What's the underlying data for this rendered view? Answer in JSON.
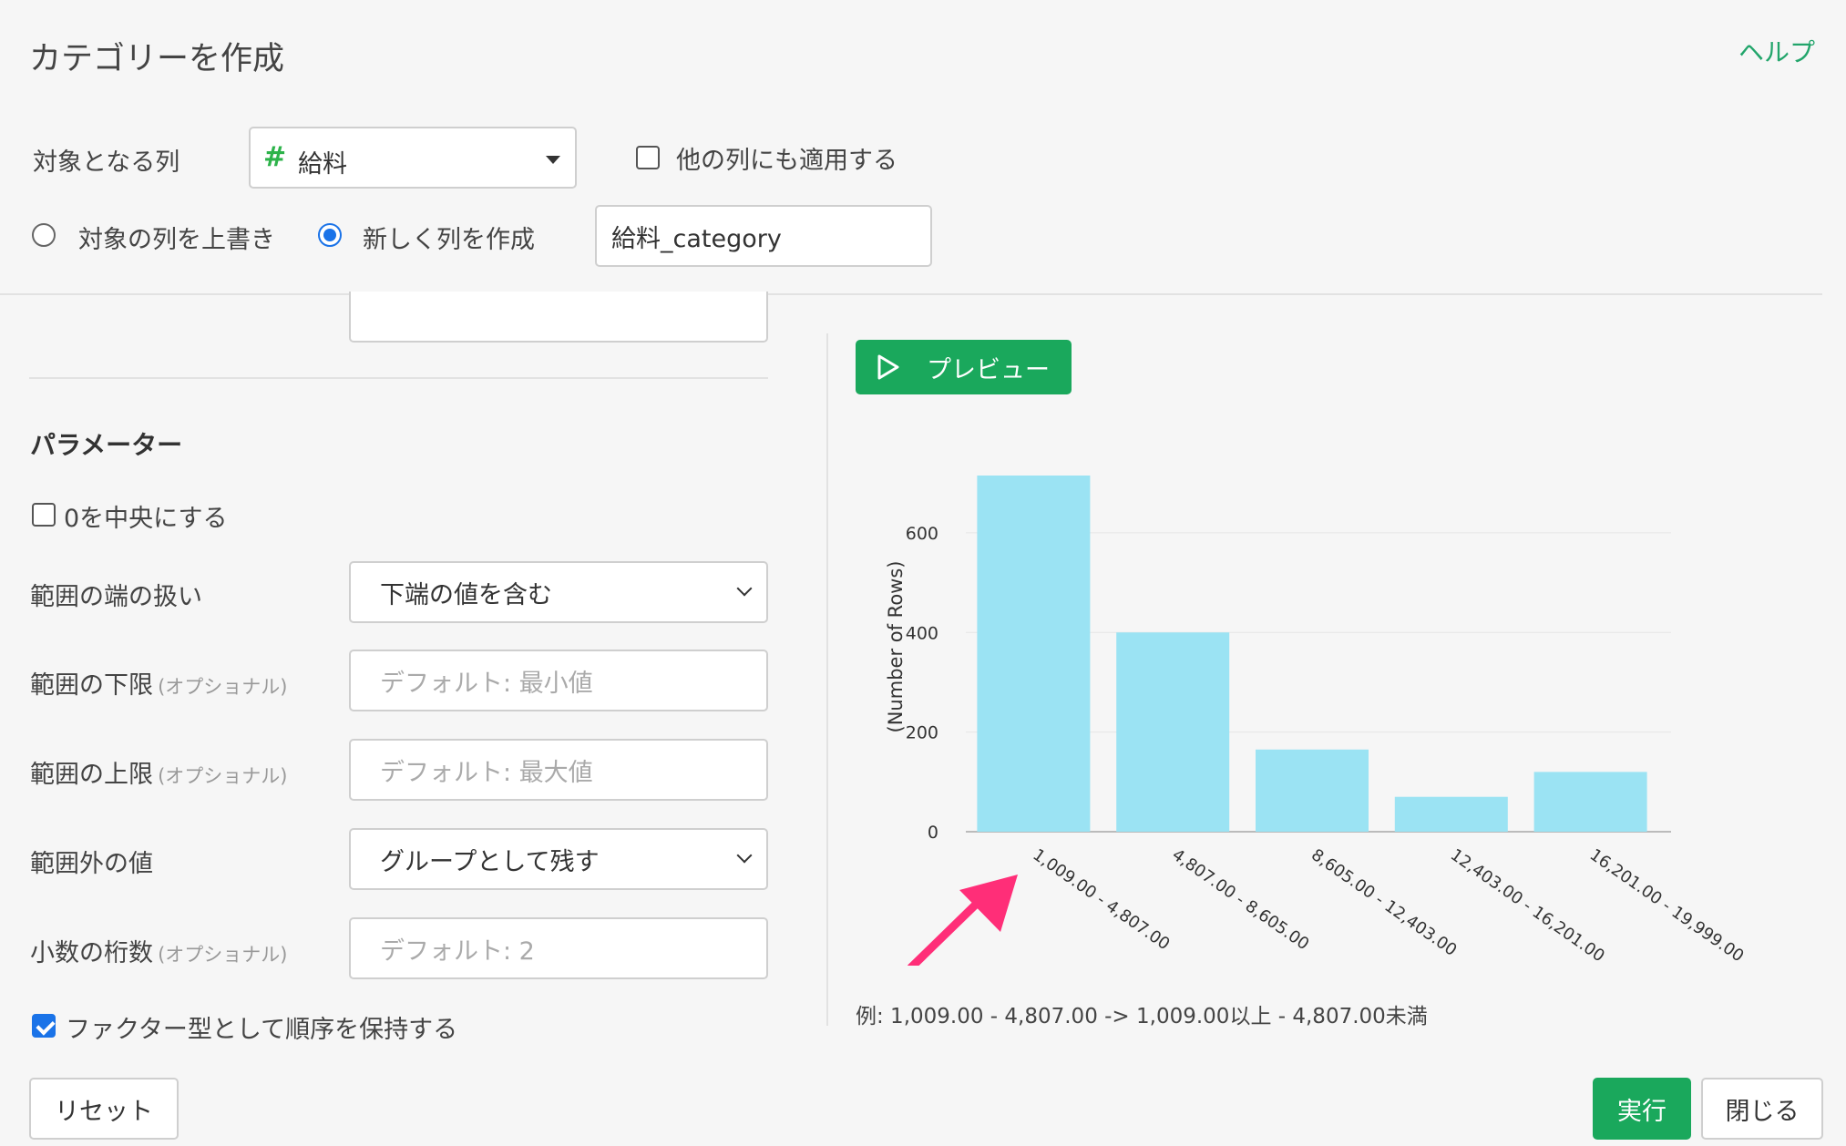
{
  "dialog": {
    "title": "カテゴリーを作成",
    "help_link": "ヘルプ"
  },
  "target": {
    "label": "対象となる列",
    "column_icon": "#",
    "column_value": "給料",
    "apply_other_label": "他の列にも適用する",
    "apply_other_checked": false
  },
  "output": {
    "overwrite_label": "対象の列を上書き",
    "new_column_label": "新しく列を作成",
    "selected": "new_column",
    "new_column_name": "給料_category"
  },
  "params": {
    "heading": "パラメーター",
    "center_zero_label": "0を中央にする",
    "center_zero_checked": false,
    "edge_label": "範囲の端の扱い",
    "edge_value": "下端の値を含む",
    "lower_label": "範囲の下限",
    "lower_optional": "(オプショナル)",
    "lower_placeholder": "デフォルト: 最小値",
    "upper_label": "範囲の上限",
    "upper_optional": "(オプショナル)",
    "upper_placeholder": "デフォルト: 最大値",
    "outside_label": "範囲外の値",
    "outside_value": "グループとして残す",
    "digits_label": "小数の桁数",
    "digits_optional": "(オプショナル)",
    "digits_placeholder": "デフォルト: 2",
    "factor_label": "ファクター型として順序を保持する",
    "factor_checked": true
  },
  "preview": {
    "button_label": "プレビュー",
    "example_text": "例: 1,009.00 - 4,807.00 -> 1,009.00以上 - 4,807.00未満"
  },
  "footer": {
    "reset_label": "リセット",
    "run_label": "実行",
    "close_label": "閉じる"
  },
  "colors": {
    "accent": "#1aa85c",
    "bar": "#9be3f3",
    "arrow": "#ff2e78",
    "link": "#22a56b"
  },
  "chart_data": {
    "type": "bar",
    "categories": [
      "1,009.00 - 4,807.00",
      "4,807.00 - 8,605.00",
      "8,605.00 - 12,403.00",
      "12,403.00 - 16,201.00",
      "16,201.00 - 19,999.00"
    ],
    "values": [
      715,
      400,
      165,
      70,
      120
    ],
    "ylabel": "(Number of Rows)",
    "yticks": [
      0,
      200,
      400,
      600
    ],
    "ylim": [
      0,
      715
    ],
    "grid": true
  }
}
